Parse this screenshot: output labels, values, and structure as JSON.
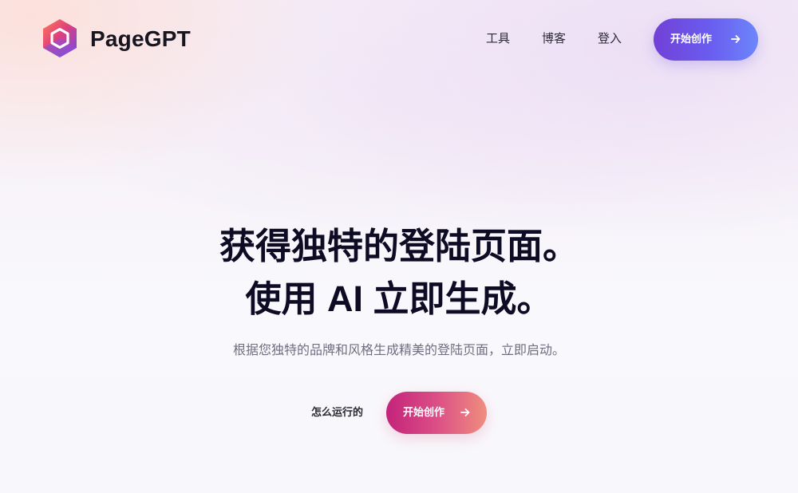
{
  "header": {
    "brand": "PageGPT",
    "logo_icon": "hexagon-logo-icon",
    "nav": {
      "tools": "工具",
      "blog": "博客",
      "login": "登入"
    },
    "cta_label": "开始创作",
    "cta_icon": "arrow-right-icon"
  },
  "hero": {
    "title_line1": "获得独特的登陆页面。",
    "title_line2": "使用 AI 立即生成。",
    "subtitle": "根据您独特的品牌和风格生成精美的登陆页面，立即启动。",
    "how_it_works": "怎么运行的",
    "cta_label": "开始创作",
    "cta_icon": "arrow-right-icon"
  },
  "colors": {
    "brand_gradient_start": "#7240d6",
    "brand_gradient_end": "#6d86fb",
    "hero_cta_start": "#c4237a",
    "hero_cta_end": "#ef8e7d",
    "title_color": "#0e0c24"
  }
}
